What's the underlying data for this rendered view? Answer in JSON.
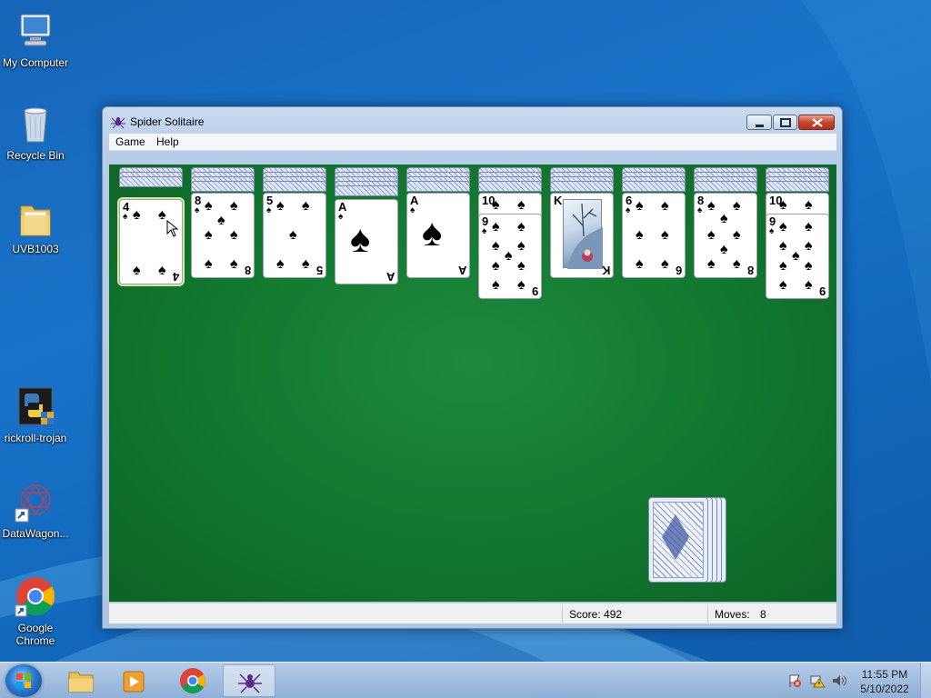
{
  "desktop": {
    "icons": [
      {
        "label": "My Computer",
        "icon": "computer-icon"
      },
      {
        "label": "Recycle Bin",
        "icon": "recycle-bin-icon"
      },
      {
        "label": "UVB1003",
        "icon": "folder-icon"
      },
      {
        "label": "rickroll-trojan",
        "icon": "python-script-icon"
      },
      {
        "label": "DataWagon...",
        "icon": "datawagon-icon"
      },
      {
        "label": "Google Chrome",
        "icon": "chrome-icon"
      }
    ]
  },
  "window": {
    "title": "Spider Solitaire",
    "menu": [
      "Game",
      "Help"
    ],
    "status": {
      "score": "Score: 492",
      "moves_label": "Moves:",
      "moves_value": "8"
    }
  },
  "tableau": [
    {
      "backs": 3,
      "top": {
        "rank": "4",
        "suit": "♠",
        "selected": true
      }
    },
    {
      "backs": 4,
      "top": {
        "rank": "8",
        "suit": "♠"
      }
    },
    {
      "backs": 4,
      "top": {
        "rank": "5",
        "suit": "♠"
      }
    },
    {
      "backs": 5,
      "top": {
        "rank": "A",
        "suit": "♠"
      }
    },
    {
      "backs": 4,
      "top": {
        "rank": "A",
        "suit": "♠"
      }
    },
    {
      "backs": 4,
      "top": {
        "rank": "10",
        "suit": "♠"
      },
      "second": {
        "rank": "9",
        "suit": "♠"
      }
    },
    {
      "backs": 4,
      "top": {
        "rank": "K",
        "suit": "♠"
      }
    },
    {
      "backs": 4,
      "top": {
        "rank": "6",
        "suit": "♠"
      }
    },
    {
      "backs": 4,
      "top": {
        "rank": "8",
        "suit": "♠"
      }
    },
    {
      "backs": 4,
      "top": {
        "rank": "10",
        "suit": "♠"
      },
      "second": {
        "rank": "9",
        "suit": "♠"
      }
    }
  ],
  "stock": {
    "deals_remaining": 4
  },
  "taskbar": {
    "pinned": [
      "folder-icon",
      "media-player-icon",
      "chrome-icon",
      "spider-solitaire-icon"
    ],
    "clock": {
      "time": "11:55 PM",
      "date": "5/10/2022"
    }
  }
}
